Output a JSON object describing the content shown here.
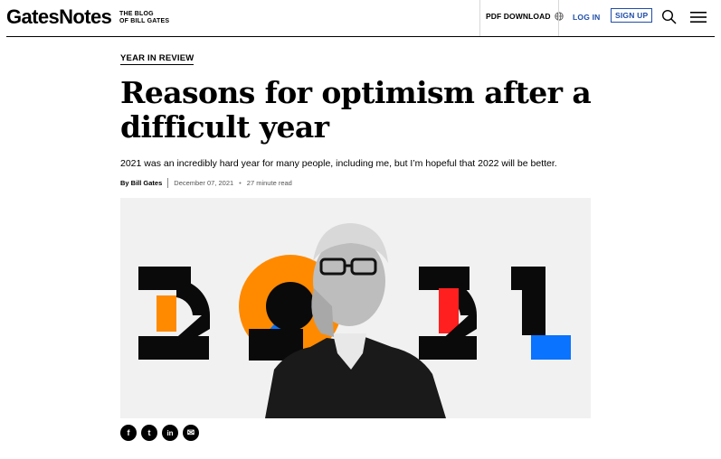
{
  "header": {
    "logo": "GatesNotes",
    "tagline_line1": "THE BLOG",
    "tagline_line2": "OF BILL GATES",
    "pdf_download": "PDF DOWNLOAD",
    "login": "LOG IN",
    "signup": "SIGN UP",
    "icons": [
      "globe-icon",
      "search-icon",
      "menu-icon"
    ]
  },
  "article": {
    "category": "YEAR IN REVIEW",
    "title": "Reasons for optimism after a difficult year",
    "subtitle": "2021 was an incredibly hard year for many people, including me, but I’m hopeful that 2022 will be better.",
    "byline": {
      "author": "By Bill Gates",
      "date": "December 07, 2021",
      "read_time": "27 minute read"
    }
  },
  "hero": {
    "numbers": "2021",
    "colors": {
      "orange": "#ff8a00",
      "red": "#ff1f1f",
      "blue": "#0a73ff",
      "black": "#0a0a0a",
      "background": "#f1f1f1"
    }
  },
  "share": {
    "buttons": [
      {
        "name": "facebook",
        "glyph": "f"
      },
      {
        "name": "twitter",
        "glyph": "t"
      },
      {
        "name": "linkedin",
        "glyph": "in"
      },
      {
        "name": "email",
        "glyph": "✉"
      }
    ]
  },
  "colors": {
    "link_blue": "#1f4ea8",
    "text": "#000000"
  }
}
